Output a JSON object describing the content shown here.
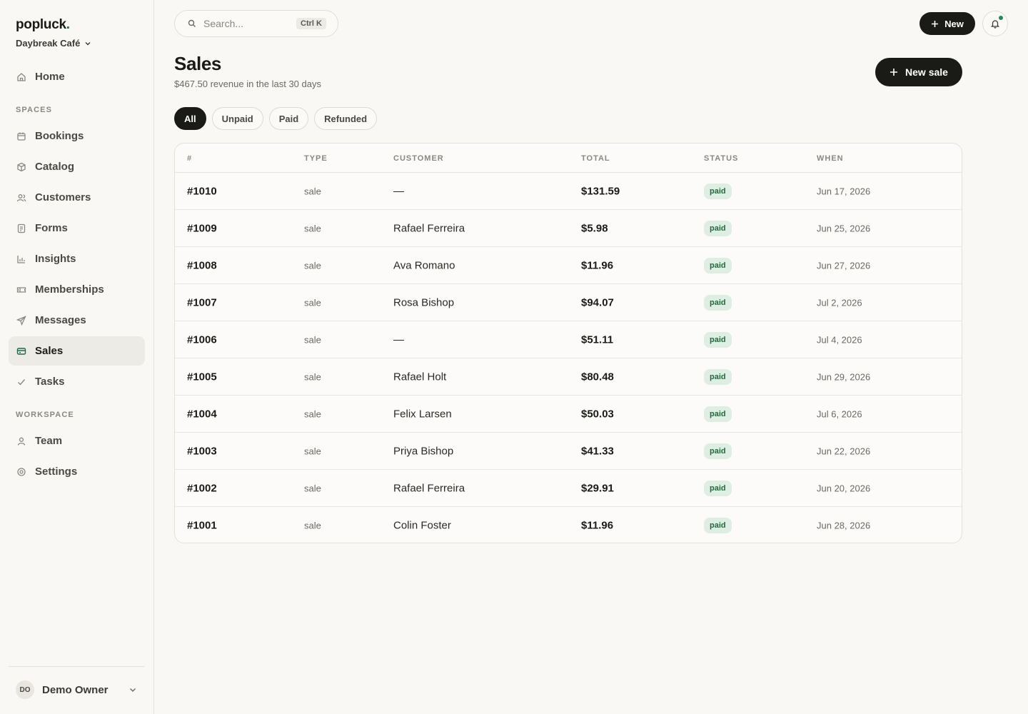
{
  "brand": {
    "name": "popluck",
    "dot": "."
  },
  "org": {
    "name": "Daybreak Café"
  },
  "sidebar": {
    "home": "Home",
    "spaces_label": "SPACES",
    "items": [
      {
        "label": "Bookings",
        "icon": "calendar-icon"
      },
      {
        "label": "Catalog",
        "icon": "box-icon"
      },
      {
        "label": "Customers",
        "icon": "users-icon"
      },
      {
        "label": "Forms",
        "icon": "form-icon"
      },
      {
        "label": "Insights",
        "icon": "chart-icon"
      },
      {
        "label": "Memberships",
        "icon": "ticket-icon"
      },
      {
        "label": "Messages",
        "icon": "send-icon"
      },
      {
        "label": "Sales",
        "icon": "card-icon"
      },
      {
        "label": "Tasks",
        "icon": "check-icon"
      }
    ],
    "workspace_label": "WORKSPACE",
    "workspace_items": [
      {
        "label": "Team",
        "icon": "user-icon"
      },
      {
        "label": "Settings",
        "icon": "gear-icon"
      }
    ],
    "user": {
      "initials": "DO",
      "name": "Demo Owner"
    }
  },
  "topbar": {
    "search_placeholder": "Search...",
    "search_shortcut": "Ctrl K",
    "new_label": "New"
  },
  "page": {
    "title": "Sales",
    "subtitle": "$467.50 revenue in the last 30 days",
    "new_sale_label": "New sale",
    "filters": [
      "All",
      "Unpaid",
      "Paid",
      "Refunded"
    ],
    "active_filter": "All"
  },
  "table": {
    "headers": {
      "id": "#",
      "type": "TYPE",
      "customer": "CUSTOMER",
      "total": "TOTAL",
      "status": "STATUS",
      "when": "WHEN"
    },
    "rows": [
      {
        "id": "#1010",
        "type": "sale",
        "customer": "—",
        "total": "$131.59",
        "status": "paid",
        "when": "Jun 17, 2026"
      },
      {
        "id": "#1009",
        "type": "sale",
        "customer": "Rafael Ferreira",
        "total": "$5.98",
        "status": "paid",
        "when": "Jun 25, 2026"
      },
      {
        "id": "#1008",
        "type": "sale",
        "customer": "Ava Romano",
        "total": "$11.96",
        "status": "paid",
        "when": "Jun 27, 2026"
      },
      {
        "id": "#1007",
        "type": "sale",
        "customer": "Rosa Bishop",
        "total": "$94.07",
        "status": "paid",
        "when": "Jul 2, 2026"
      },
      {
        "id": "#1006",
        "type": "sale",
        "customer": "—",
        "total": "$51.11",
        "status": "paid",
        "when": "Jul 4, 2026"
      },
      {
        "id": "#1005",
        "type": "sale",
        "customer": "Rafael Holt",
        "total": "$80.48",
        "status": "paid",
        "when": "Jun 29, 2026"
      },
      {
        "id": "#1004",
        "type": "sale",
        "customer": "Felix Larsen",
        "total": "$50.03",
        "status": "paid",
        "when": "Jul 6, 2026"
      },
      {
        "id": "#1003",
        "type": "sale",
        "customer": "Priya Bishop",
        "total": "$41.33",
        "status": "paid",
        "when": "Jun 22, 2026"
      },
      {
        "id": "#1002",
        "type": "sale",
        "customer": "Rafael Ferreira",
        "total": "$29.91",
        "status": "paid",
        "when": "Jun 20, 2026"
      },
      {
        "id": "#1001",
        "type": "sale",
        "customer": "Colin Foster",
        "total": "$11.96",
        "status": "paid",
        "when": "Jun 28, 2026"
      }
    ]
  },
  "colors": {
    "accent": "#1f6b4b",
    "primary_button": "#1a1a17",
    "paid_badge_bg": "#dfeee3",
    "paid_badge_text": "#1f6b3b",
    "notification_dot": "#1f8a5b"
  }
}
